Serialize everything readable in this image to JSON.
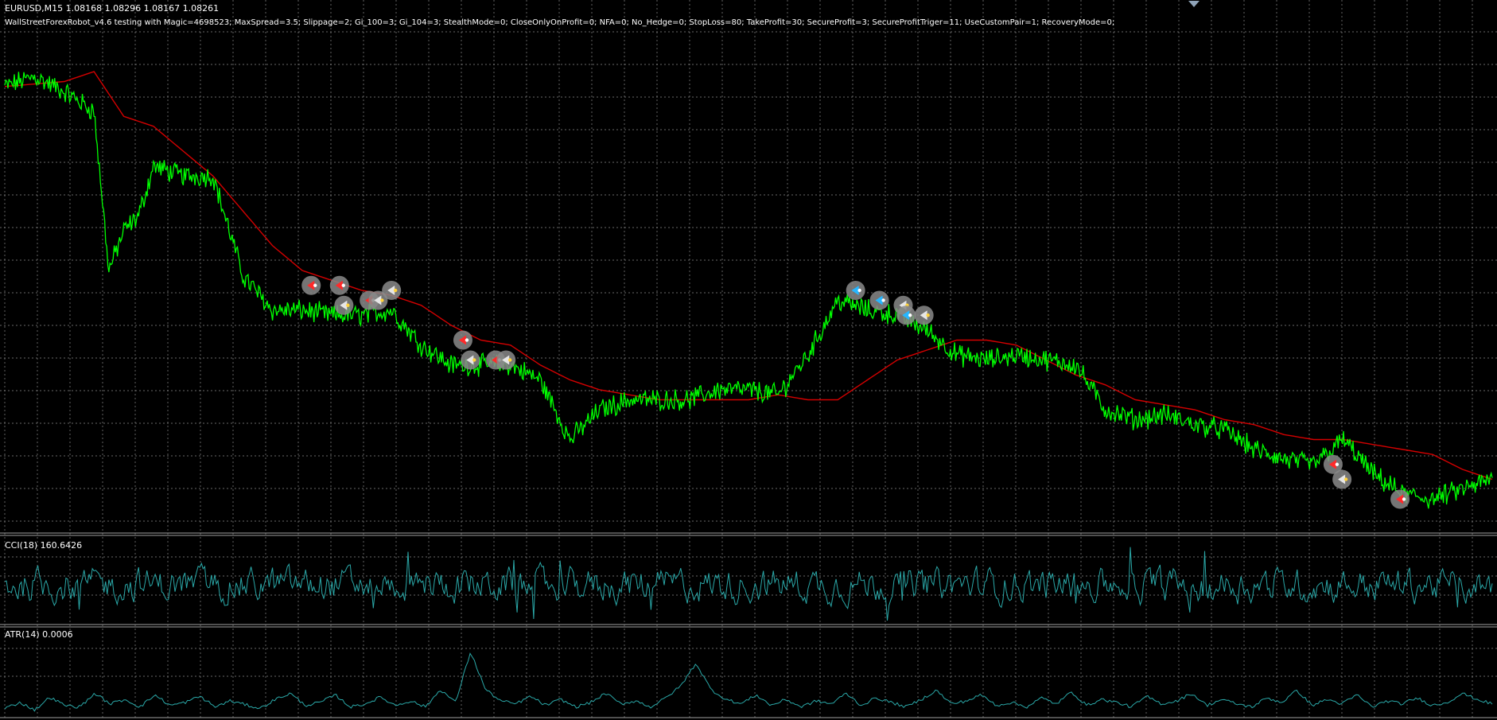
{
  "header": {
    "symbol_line": "EURUSD,M15  1.08168 1.08296 1.08167 1.08261",
    "ea_line": "WallStreetForexRobot_v4.6 testing with Magic=4698523; MaxSpread=3.5; Slippage=2; Gi_100=3; Gi_104=3; StealthMode=0; CloseOnlyOnProfit=0; NFA=0; No_Hedge=0; StopLoss=80; TakeProfit=30; SecureProfit=3; SecureProfitTriger=11; UseCustomPair=1; RecoveryMode=0;"
  },
  "colors": {
    "background": "#000000",
    "grid": "#8c8c8c",
    "price": "#00ff00",
    "moving_average": "#d40000",
    "indicator": "#2aa8a8",
    "separator": "#a0a0a0",
    "marker_ring": "#8a8a8a",
    "sell_marker": "#ff2a2a",
    "buy_marker": "#27b6ff",
    "close_marker": "#ffd23c"
  },
  "chart_data": [
    {
      "type": "line",
      "pane": "price",
      "ylim": [
        0,
        1
      ],
      "grid": true,
      "price_series": {
        "x": [
          0,
          2,
          4,
          6,
          7,
          8,
          9,
          10,
          12,
          14,
          16,
          18,
          20,
          22,
          24,
          26,
          28,
          30,
          32,
          34,
          36,
          38,
          40,
          42,
          44,
          46,
          48,
          50,
          52,
          54,
          56,
          58,
          60,
          62,
          64,
          66,
          68,
          70,
          72,
          74,
          76,
          78,
          80,
          82,
          84,
          86,
          88,
          90,
          92,
          94,
          96,
          98,
          100
        ],
        "y": [
          0.89,
          0.91,
          0.88,
          0.84,
          0.52,
          0.6,
          0.63,
          0.73,
          0.71,
          0.71,
          0.51,
          0.44,
          0.44,
          0.43,
          0.43,
          0.44,
          0.37,
          0.33,
          0.33,
          0.33,
          0.3,
          0.18,
          0.24,
          0.26,
          0.26,
          0.26,
          0.28,
          0.28,
          0.27,
          0.35,
          0.46,
          0.44,
          0.43,
          0.4,
          0.35,
          0.34,
          0.35,
          0.34,
          0.33,
          0.24,
          0.22,
          0.23,
          0.21,
          0.2,
          0.16,
          0.14,
          0.13,
          0.18,
          0.11,
          0.07,
          0.06,
          0.08,
          0.1
        ]
      },
      "ma_series": {
        "x": [
          0,
          4,
          6,
          8,
          10,
          12,
          14,
          16,
          18,
          20,
          22,
          24,
          26,
          28,
          30,
          32,
          34,
          36,
          38,
          40,
          42,
          44,
          46,
          48,
          50,
          52,
          54,
          56,
          58,
          60,
          62,
          64,
          66,
          68,
          70,
          72,
          74,
          76,
          78,
          80,
          82,
          84,
          86,
          88,
          90,
          92,
          94,
          96,
          98,
          100
        ],
        "y": [
          0.89,
          0.9,
          0.92,
          0.83,
          0.81,
          0.76,
          0.71,
          0.64,
          0.57,
          0.52,
          0.5,
          0.48,
          0.47,
          0.45,
          0.41,
          0.38,
          0.37,
          0.33,
          0.3,
          0.28,
          0.27,
          0.26,
          0.26,
          0.26,
          0.26,
          0.27,
          0.26,
          0.26,
          0.3,
          0.34,
          0.36,
          0.38,
          0.38,
          0.37,
          0.34,
          0.31,
          0.29,
          0.26,
          0.25,
          0.24,
          0.22,
          0.21,
          0.19,
          0.18,
          0.18,
          0.17,
          0.16,
          0.15,
          0.12,
          0.1
        ]
      },
      "trade_markers": [
        {
          "x": 20.6,
          "y": 0.49,
          "side": "sell"
        },
        {
          "x": 22.5,
          "y": 0.49,
          "side": "sell"
        },
        {
          "x": 22.8,
          "y": 0.45,
          "side": "close"
        },
        {
          "x": 24.5,
          "y": 0.46,
          "side": "sell"
        },
        {
          "x": 25.1,
          "y": 0.46,
          "side": "close"
        },
        {
          "x": 26.0,
          "y": 0.48,
          "side": "close"
        },
        {
          "x": 30.8,
          "y": 0.38,
          "side": "sell"
        },
        {
          "x": 31.3,
          "y": 0.34,
          "side": "close"
        },
        {
          "x": 33.0,
          "y": 0.34,
          "side": "sell"
        },
        {
          "x": 33.7,
          "y": 0.34,
          "side": "close"
        },
        {
          "x": 57.2,
          "y": 0.48,
          "side": "buy"
        },
        {
          "x": 58.8,
          "y": 0.46,
          "side": "buy"
        },
        {
          "x": 60.4,
          "y": 0.45,
          "side": "close"
        },
        {
          "x": 60.6,
          "y": 0.43,
          "side": "buy"
        },
        {
          "x": 61.8,
          "y": 0.43,
          "side": "close"
        },
        {
          "x": 89.3,
          "y": 0.13,
          "side": "sell"
        },
        {
          "x": 89.9,
          "y": 0.1,
          "side": "close"
        },
        {
          "x": 93.8,
          "y": 0.06,
          "side": "sell"
        }
      ]
    },
    {
      "type": "line",
      "pane": "cci",
      "title": "CCI(18) 160.6426",
      "ylim": [
        -1,
        1
      ],
      "grid": true
    },
    {
      "type": "line",
      "pane": "atr",
      "title": "ATR(14) 0.0006",
      "ylim": [
        0,
        1
      ],
      "grid": true,
      "values": [
        0.1,
        0.18,
        0.08,
        0.25,
        0.14,
        0.12,
        0.3,
        0.16,
        0.22,
        0.12,
        0.28,
        0.14,
        0.18,
        0.26,
        0.12,
        0.2,
        0.15,
        0.1,
        0.22,
        0.3,
        0.14,
        0.18,
        0.28,
        0.12,
        0.16,
        0.25,
        0.14,
        0.2,
        0.12,
        0.35,
        0.18,
        0.85,
        0.35,
        0.2,
        0.16,
        0.26,
        0.14,
        0.22,
        0.12,
        0.18,
        0.3,
        0.16,
        0.2,
        0.12,
        0.24,
        0.4,
        0.7,
        0.35,
        0.22,
        0.16,
        0.28,
        0.14,
        0.22,
        0.12,
        0.2,
        0.16,
        0.3,
        0.14,
        0.24,
        0.18,
        0.12,
        0.22,
        0.34,
        0.16,
        0.2,
        0.28,
        0.14,
        0.18,
        0.12,
        0.24,
        0.16,
        0.32,
        0.14,
        0.22,
        0.18,
        0.12,
        0.26,
        0.16,
        0.2,
        0.3,
        0.14,
        0.22,
        0.16,
        0.12,
        0.24,
        0.18,
        0.34,
        0.14,
        0.22,
        0.16,
        0.28,
        0.12,
        0.2,
        0.16,
        0.24,
        0.14,
        0.18,
        0.3,
        0.22,
        0.16
      ]
    }
  ]
}
